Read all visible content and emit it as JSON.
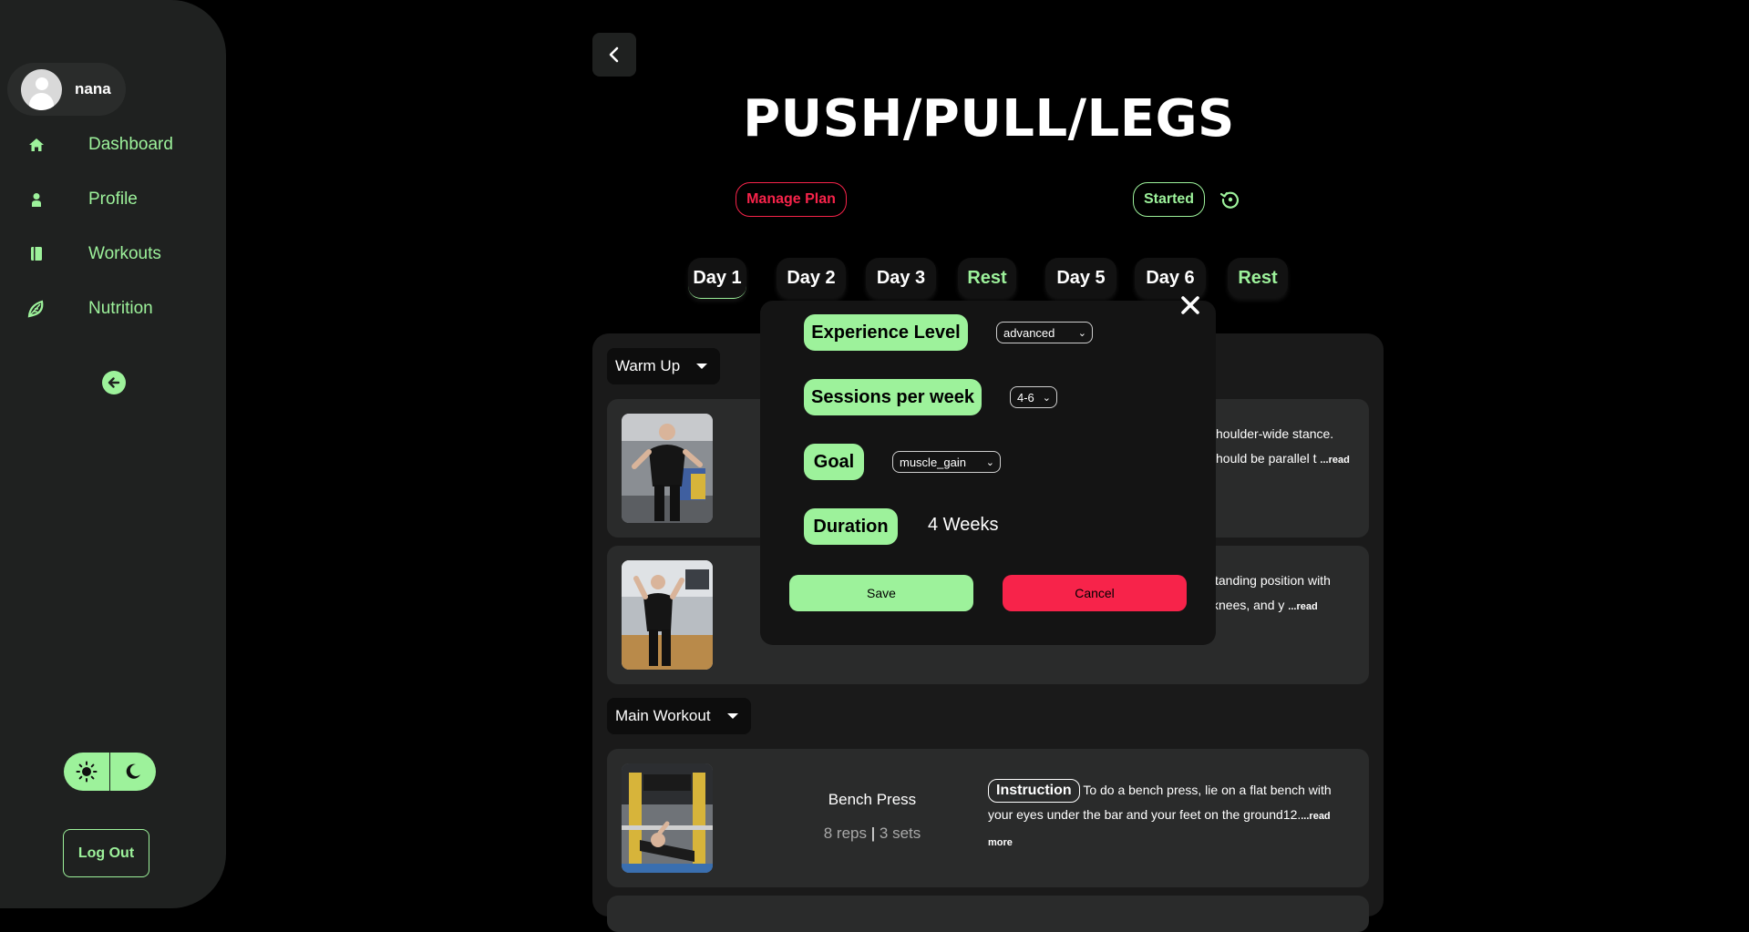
{
  "user": {
    "name": "nana"
  },
  "sidebar": {
    "items": [
      {
        "label": "Dashboard",
        "icon": "home-icon"
      },
      {
        "label": "Profile",
        "icon": "person-icon"
      },
      {
        "label": "Workouts",
        "icon": "book-icon"
      },
      {
        "label": "Nutrition",
        "icon": "leaf-icon"
      }
    ],
    "logout_label": "Log Out"
  },
  "plan": {
    "title": "PUSH/PULL/LEGS",
    "manage_label": "Manage Plan",
    "status_label": "Started"
  },
  "days": [
    "Day 1",
    "Day 2",
    "Day 3",
    "Rest",
    "Day 5",
    "Day 6",
    "Rest"
  ],
  "sections": {
    "warmup_label": "Warm Up",
    "main_label": "Main Workout"
  },
  "warmup_cards": [
    {
      "text_line1": "houlder-wide stance.",
      "text_line2": "hould be parallel t",
      "read_more": "...read"
    },
    {
      "text_line1": "standing position with",
      "text_line2": "knees, and y",
      "read_more": "...read"
    }
  ],
  "main_exercise": {
    "name": "Bench Press",
    "reps": "8 reps",
    "separator": "|",
    "sets": "3 sets",
    "instruction_label": "Instruction",
    "description": "To do a bench press, lie on a flat bench with your eyes under the bar and your feet on the ground12.",
    "read_more": "...read more"
  },
  "modal": {
    "experience_label": "Experience Level",
    "experience_value": "advanced",
    "sessions_label": "Sessions per week",
    "sessions_value": "4-6",
    "goal_label": "Goal",
    "goal_value": "muscle_gain",
    "duration_label": "Duration",
    "duration_value": "4 Weeks",
    "save_label": "Save",
    "cancel_label": "Cancel"
  },
  "colors": {
    "accent": "#9df29b",
    "danger": "#f7234a",
    "sidebar_bg": "#1f2120",
    "card_bg": "#2a2b2b"
  }
}
